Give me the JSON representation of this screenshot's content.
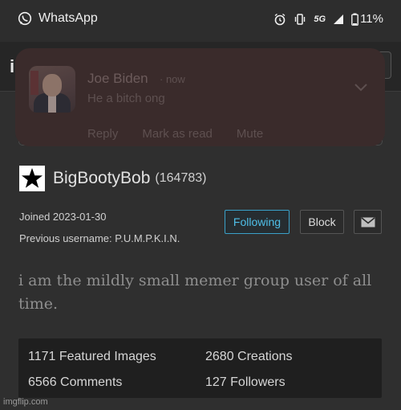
{
  "status_bar": {
    "app_name": "WhatsApp",
    "network": "5G",
    "battery": "11%",
    "icons": [
      "whatsapp-icon",
      "alarm-icon",
      "vibrate-icon",
      "signal-icon",
      "battery-icon"
    ]
  },
  "header": {
    "letter": "i"
  },
  "notification": {
    "sender": "Joe Biden",
    "time": "· now",
    "message": "He a bitch ong",
    "actions": {
      "reply": "Reply",
      "mark_read": "Mark as read",
      "mute": "Mute"
    }
  },
  "profile": {
    "username": "BigBootyBob",
    "user_id": "(164783)",
    "joined": "Joined 2023-01-30",
    "previous_username": "Previous username: P.U.M.P.K.I.N.",
    "bio": "i am the mildly small memer group user of all time."
  },
  "buttons": {
    "following": "Following",
    "block": "Block"
  },
  "stats": {
    "featured": "1171 Featured Images",
    "creations": "2680 Creations",
    "comments": "6566 Comments",
    "followers": "127 Followers"
  },
  "watermark": "imgflip.com",
  "colors": {
    "accent": "#4fbfe8",
    "background": "#2f2f2f",
    "notification_bg": "#3a2b2b"
  }
}
